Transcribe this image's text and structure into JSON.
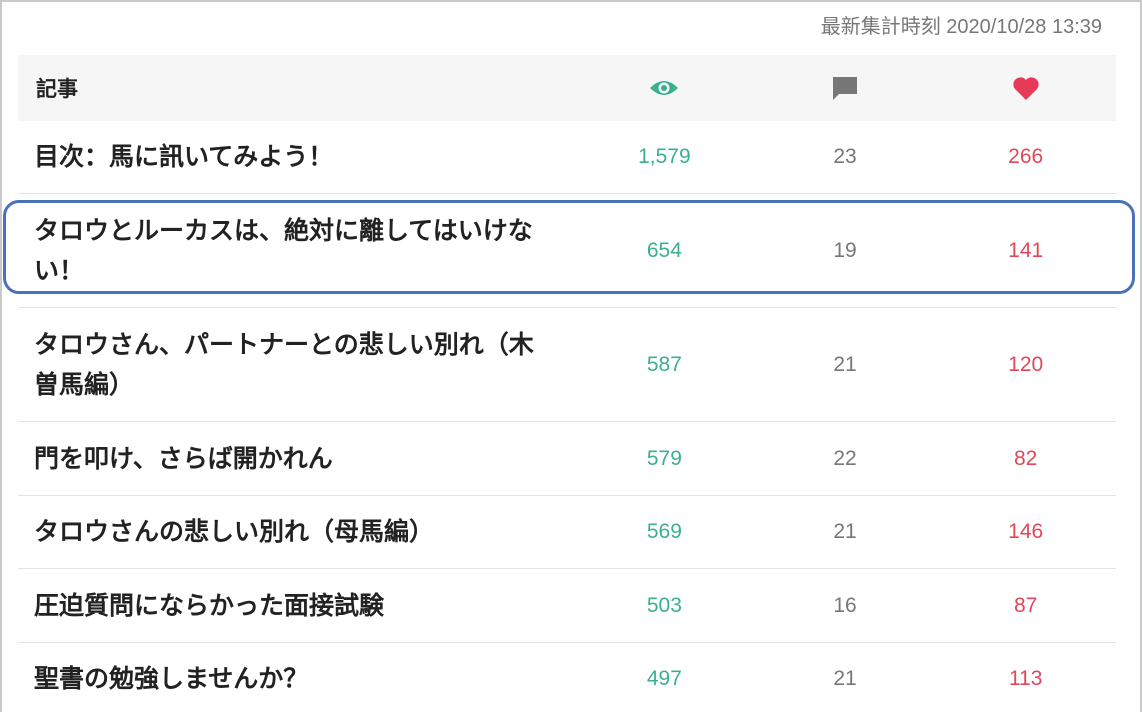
{
  "timestamp": "最新集計時刻 2020/10/28 13:39",
  "header": {
    "article_label": "記事",
    "icons": [
      "eye-icon",
      "comment-icon",
      "heart-icon"
    ]
  },
  "colors": {
    "views": "#3bb08f",
    "comments": "#777777",
    "likes": "#e0485a",
    "highlight": "#4a72b8"
  },
  "rows": [
    {
      "title": "目次：馬に訊いてみよう！",
      "views": "1,579",
      "comments": "23",
      "likes": "266"
    },
    {
      "title": "タロウとルーカスは、絶対に離してはいけない！",
      "views": "654",
      "comments": "19",
      "likes": "141"
    },
    {
      "title": "タロウさん、パートナーとの悲しい別れ（木曽馬編）",
      "views": "587",
      "comments": "21",
      "likes": "120"
    },
    {
      "title": "門を叩け、さらば開かれん",
      "views": "579",
      "comments": "22",
      "likes": "82"
    },
    {
      "title": "タロウさんの悲しい別れ（母馬編）",
      "views": "569",
      "comments": "21",
      "likes": "146"
    },
    {
      "title": "圧迫質問にならかった面接試験",
      "views": "503",
      "comments": "16",
      "likes": "87"
    },
    {
      "title": "聖書の勉強しませんか？",
      "views": "497",
      "comments": "21",
      "likes": "113"
    }
  ]
}
